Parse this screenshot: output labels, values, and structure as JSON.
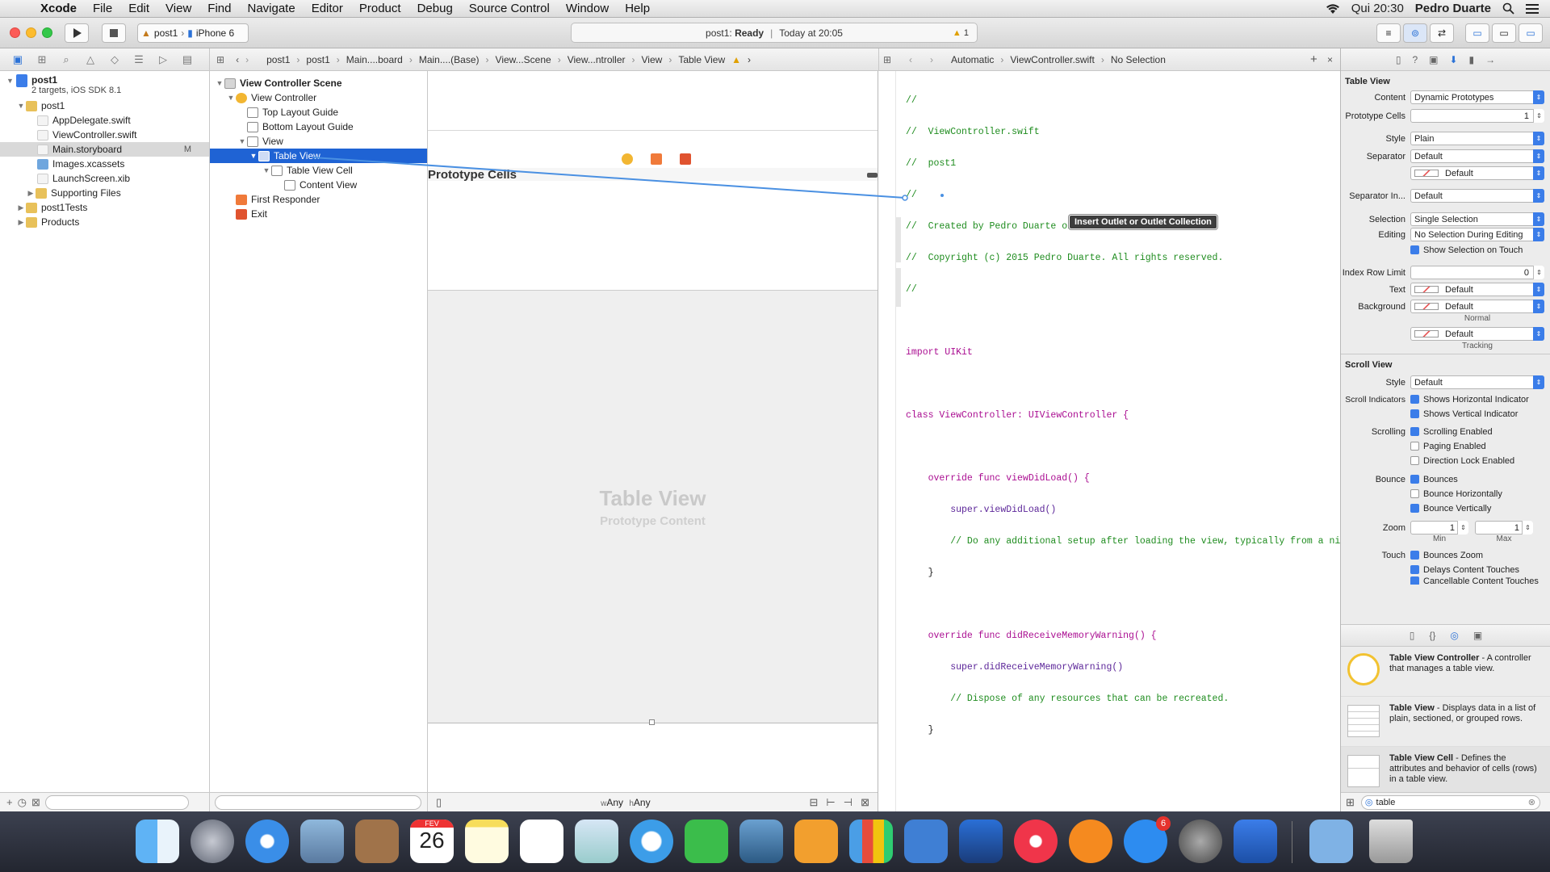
{
  "menubar": {
    "app_name": "Xcode",
    "items": [
      "File",
      "Edit",
      "View",
      "Find",
      "Navigate",
      "Editor",
      "Product",
      "Debug",
      "Source Control",
      "Window",
      "Help"
    ],
    "clock": "Qui 20:30",
    "user": "Pedro Duarte"
  },
  "toolbar": {
    "scheme": "post1",
    "device": "iPhone 6",
    "status_project": "post1:",
    "status_state": "Ready",
    "status_time": "Today at 20:05",
    "warning_count": "1"
  },
  "navigator": {
    "project_name": "post1",
    "project_sub": "2 targets, iOS SDK 8.1",
    "items": [
      {
        "label": "post1",
        "depth": 1,
        "kind": "folder",
        "open": true
      },
      {
        "label": "AppDelegate.swift",
        "depth": 2,
        "kind": "swift"
      },
      {
        "label": "ViewController.swift",
        "depth": 2,
        "kind": "swift"
      },
      {
        "label": "Main.storyboard",
        "depth": 2,
        "kind": "storyboard",
        "badge": "M",
        "selected": true
      },
      {
        "label": "Images.xcassets",
        "depth": 2,
        "kind": "assets"
      },
      {
        "label": "LaunchScreen.xib",
        "depth": 2,
        "kind": "xib"
      },
      {
        "label": "Supporting Files",
        "depth": 2,
        "kind": "folder",
        "open": false
      },
      {
        "label": "post1Tests",
        "depth": 1,
        "kind": "folder",
        "open": false
      },
      {
        "label": "Products",
        "depth": 1,
        "kind": "folder",
        "open": false
      }
    ]
  },
  "jumpbar": {
    "left": [
      "post1",
      "post1",
      "Main....board",
      "Main....(Base)",
      "View...Scene",
      "View...ntroller",
      "View",
      "Table View"
    ],
    "right": [
      "Automatic",
      "ViewController.swift",
      "No Selection"
    ]
  },
  "outline": {
    "items": [
      {
        "label": "View Controller Scene",
        "depth": 0,
        "bold": true
      },
      {
        "label": "View Controller",
        "depth": 1
      },
      {
        "label": "Top Layout Guide",
        "depth": 2
      },
      {
        "label": "Bottom Layout Guide",
        "depth": 2
      },
      {
        "label": "View",
        "depth": 2
      },
      {
        "label": "Table View",
        "depth": 3,
        "selected": true
      },
      {
        "label": "Table View Cell",
        "depth": 4
      },
      {
        "label": "Content View",
        "depth": 5
      },
      {
        "label": "First Responder",
        "depth": 1
      },
      {
        "label": "Exit",
        "depth": 1
      }
    ]
  },
  "canvas": {
    "prototype_header": "Prototype Cells",
    "table_title": "Table View",
    "table_sub": "Prototype Content",
    "size_class_w": "Any",
    "size_class_h": "Any",
    "size_w_prefix": "w",
    "size_h_prefix": "h"
  },
  "code": {
    "lines": [
      "//",
      "//  ViewController.swift",
      "//  post1",
      "//",
      "//  Created by Pedro Duarte on 26/02/15.",
      "//  Copyright (c) 2015 Pedro Duarte. All rights reserved.",
      "//",
      "",
      "import UIKit",
      "",
      "class ViewController: UIViewController {",
      "",
      "    override func viewDidLoad() {",
      "        super.viewDidLoad()",
      "        // Do any additional setup after loading the view, typically from a nib.",
      "    }",
      "",
      "    override func didReceiveMemoryWarning() {",
      "        super.didReceiveMemoryWarning()",
      "        // Dispose of any resources that can be recreated.",
      "    }",
      "",
      "",
      "}"
    ],
    "tooltip": "Insert Outlet or Outlet Collection"
  },
  "inspector": {
    "table_view_title": "Table View",
    "content": "Dynamic Prototypes",
    "prototype_cells": "1",
    "style": "Plain",
    "separator": "Default",
    "separator_color": "Default",
    "separator_inset": "Default",
    "selection": "Single Selection",
    "editing": "No Selection During Editing",
    "show_selection_on_touch": "Show Selection on Touch",
    "index_row_limit": "0",
    "text_color": "Default",
    "background_normal": "Default",
    "normal_caption": "Normal",
    "background_tracking": "Default",
    "tracking_caption": "Tracking",
    "labels": {
      "content": "Content",
      "prototype_cells": "Prototype Cells",
      "style": "Style",
      "separator": "Separator",
      "separator_inset": "Separator In...",
      "selection": "Selection",
      "editing": "Editing",
      "index_row_limit": "Index Row Limit",
      "text": "Text",
      "background": "Background",
      "scroll_style": "Style",
      "scroll_indicators": "Scroll Indicators",
      "scrolling": "Scrolling",
      "bounce": "Bounce",
      "zoom": "Zoom",
      "touch": "Touch"
    },
    "scroll_view_title": "Scroll View",
    "scroll_style": "Default",
    "shows_h": "Shows Horizontal Indicator",
    "shows_v": "Shows Vertical Indicator",
    "scrolling_enabled": "Scrolling Enabled",
    "paging_enabled": "Paging Enabled",
    "direction_lock": "Direction Lock Enabled",
    "bounces": "Bounces",
    "bounce_h": "Bounce Horizontally",
    "bounce_v": "Bounce Vertically",
    "zoom_min": "1",
    "zoom_max": "1",
    "min_caption": "Min",
    "max_caption": "Max",
    "bounces_zoom": "Bounces Zoom",
    "delays_content": "Delays Content Touches",
    "cancellable": "Cancellable Content Touches"
  },
  "library": {
    "items": [
      {
        "title": "Table View Controller",
        "desc": " - A controller that manages a table view."
      },
      {
        "title": "Table View",
        "desc": " - Displays data in a list of plain, sectioned, or grouped rows."
      },
      {
        "title": "Table View Cell",
        "desc": " - Defines the attributes and behavior of cells (rows) in a table view."
      }
    ],
    "search_value": "table"
  },
  "dock": {
    "calendar_month": "FEV",
    "calendar_day": "26",
    "appstore_badge": "6"
  },
  "colors": {
    "selection_blue": "#1f63d4",
    "accent": "#3b7de9",
    "connection_line": "#4a90e2"
  }
}
